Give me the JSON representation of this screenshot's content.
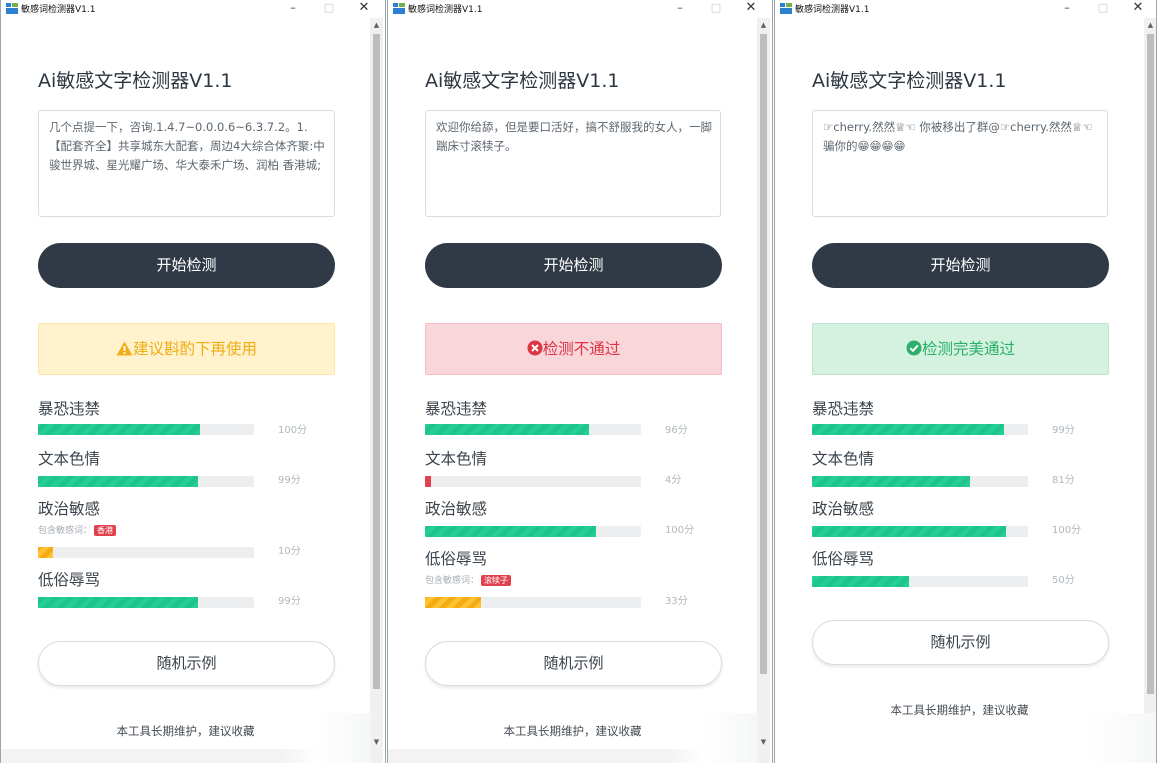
{
  "colors": {
    "accent_dark": "#2f3a46",
    "bar_green": "#23cf96",
    "bar_orange": "#ffc233",
    "bar_red": "#e0414f",
    "warn": "#f0ad16",
    "error": "#dc3544",
    "success": "#2ab06a"
  },
  "windows": [
    {
      "title": "敏感词检测器V1.1",
      "controls": {
        "minimize": "–",
        "maximize": "□",
        "close": "✕"
      },
      "heading": "Ai敏感文字检测器V1.1",
      "input_text": "几个点提一下，咨询.1.4.7~0.0.0.6~6.3.7.2。1.【配套齐全】共享城东大配套，周边4大综合体齐聚:中骏世界城、星光耀广场、华大泰禾广场、润柏 香港城;",
      "detect_button": "开始检测",
      "result": {
        "type": "warn",
        "icon": "warning-icon",
        "text": "建议斟酌下再使用"
      },
      "metrics": [
        {
          "label": "暴恐违禁",
          "value": "100分",
          "level": 0.75,
          "color": "green"
        },
        {
          "label": "文本色情",
          "value": "99分",
          "level": 0.74,
          "color": "green"
        },
        {
          "label": "政治敏感",
          "value": "10分",
          "level": 0.07,
          "color": "orange",
          "sub_label": "包含敏感词：",
          "tag": "香港"
        },
        {
          "label": "低俗辱骂",
          "value": "99分",
          "level": 0.74,
          "color": "green"
        }
      ],
      "random_button": "随机示例",
      "footer": "本工具长期维护，建议收藏"
    },
    {
      "title": "敏感词检测器V1.1",
      "controls": {
        "minimize": "–",
        "maximize": "□",
        "close": "✕"
      },
      "heading": "Ai敏感文字检测器V1.1",
      "input_text": "欢迎你给舔，但是要口活好，搞不舒服我的女人，一脚踹床寸滚犊子。",
      "detect_button": "开始检测",
      "result": {
        "type": "err",
        "icon": "error-circle-icon",
        "text": "检测不通过"
      },
      "metrics": [
        {
          "label": "暴恐违禁",
          "value": "96分",
          "level": 0.76,
          "color": "green"
        },
        {
          "label": "文本色情",
          "value": "4分",
          "level": 0.03,
          "color": "red"
        },
        {
          "label": "政治敏感",
          "value": "100分",
          "level": 0.79,
          "color": "green"
        },
        {
          "label": "低俗辱骂",
          "value": "33分",
          "level": 0.26,
          "color": "orange",
          "sub_label": "包含敏感词：",
          "tag": "滚犊子"
        }
      ],
      "random_button": "随机示例",
      "footer": "本工具长期维护，建议收藏"
    },
    {
      "title": "敏感词检测器V1.1",
      "controls": {
        "minimize": "–",
        "maximize": "□",
        "close": "✕"
      },
      "heading": "Ai敏感文字检测器V1.1",
      "input_text": "☞cherry.然然♕☜ 你被移出了群@☞cherry.然然♕☜ 骗你的😁😁😁😁",
      "detect_button": "开始检测",
      "result": {
        "type": "ok",
        "icon": "check-circle-icon",
        "text": "检测完美通过"
      },
      "metrics": [
        {
          "label": "暴恐违禁",
          "value": "99分",
          "level": 0.89,
          "color": "green"
        },
        {
          "label": "文本色情",
          "value": "81分",
          "level": 0.73,
          "color": "green"
        },
        {
          "label": "政治敏感",
          "value": "100分",
          "level": 0.9,
          "color": "green"
        },
        {
          "label": "低俗辱骂",
          "value": "50分",
          "level": 0.45,
          "color": "green"
        }
      ],
      "random_button": "随机示例",
      "footer": "本工具长期维护，建议收藏"
    }
  ]
}
